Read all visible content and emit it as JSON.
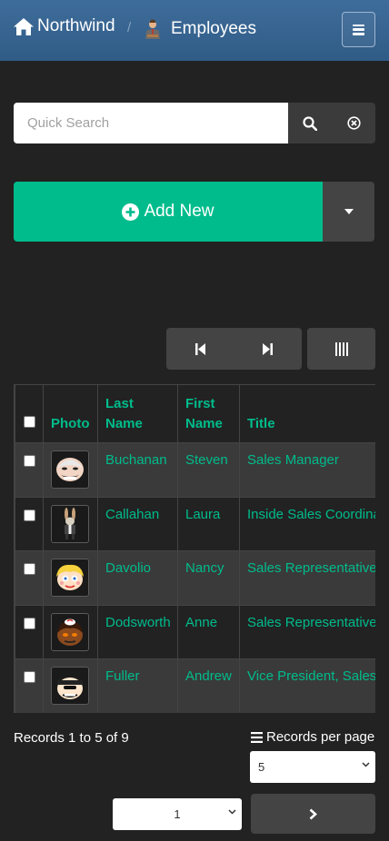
{
  "navbar": {
    "brand": "Northwind",
    "separator": "/",
    "page_title": "Employees"
  },
  "search": {
    "placeholder": "Quick Search",
    "value": ""
  },
  "toolbar": {
    "add_label": "Add New"
  },
  "table": {
    "headers": {
      "photo": "Photo",
      "last_name": "Last Name",
      "first_name": "First Name",
      "title": "Title"
    },
    "rows": [
      {
        "last": "Buchanan",
        "first": "Steven",
        "title": "Sales Manager",
        "photo": "avatar-bald"
      },
      {
        "last": "Callahan",
        "first": "Laura",
        "title": "Inside Sales Coordinator",
        "photo": "avatar-rabbit"
      },
      {
        "last": "Davolio",
        "first": "Nancy",
        "title": "Sales Representative",
        "photo": "avatar-blonde"
      },
      {
        "last": "Dodsworth",
        "first": "Anne",
        "title": "Sales Representative",
        "photo": "avatar-dark"
      },
      {
        "last": "Fuller",
        "first": "Andrew",
        "title": "Vice President, Sales",
        "photo": "avatar-cap"
      }
    ]
  },
  "footer": {
    "records_text": "Records 1 to 5 of 9",
    "records_per_page_label": "Records per page",
    "records_per_page_value": "5",
    "page_value": "1"
  },
  "colors": {
    "accent": "#00bc8c",
    "navbar": "#375a7f",
    "background": "#222222",
    "button": "#444444"
  }
}
